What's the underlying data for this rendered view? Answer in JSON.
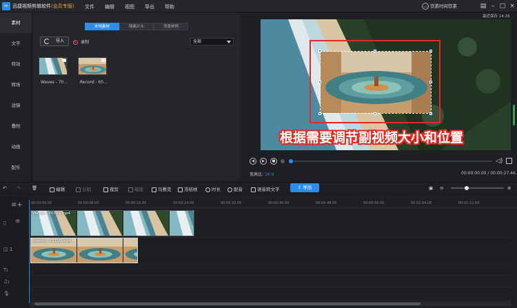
{
  "app": {
    "title": "迅捷视频剪辑软件",
    "edition": "(会员专版)",
    "menu": [
      "文件",
      "编辑",
      "视图",
      "导出",
      "帮助"
    ],
    "user": "饮茶时间饮茶",
    "save_status": "最近保存 14:26",
    "accent": "#2f8dea"
  },
  "sidebar": {
    "items": [
      {
        "label": "素材",
        "active": true
      },
      {
        "label": "文字"
      },
      {
        "label": "特效"
      },
      {
        "label": "转场"
      },
      {
        "label": "滤镜"
      },
      {
        "label": "叠附"
      },
      {
        "label": "动画"
      },
      {
        "label": "配乐"
      }
    ]
  },
  "media": {
    "tabs": [
      "本地素材",
      "隔离片头",
      "背景样例"
    ],
    "import_label": "导入",
    "record_label": "录制",
    "filter_value": "全部",
    "items": [
      {
        "name": "Waves - 70..."
      },
      {
        "name": "Record - 65..."
      }
    ]
  },
  "preview": {
    "caption": "根据需要调节副视频大小和位置",
    "aspect_label": "宽高比:",
    "aspect_value": "16:9",
    "timecode": "00:00:00.00 / 00:00:27.46",
    "progress": 0.0
  },
  "toolbar": {
    "edit": "编辑",
    "split": "分割",
    "crop": "裁剪",
    "zoom": "缩放",
    "mosaic": "马赛克",
    "freeze": "冻结帧",
    "duration": "时长",
    "dub": "配音",
    "tts": "语音转文字",
    "export": "导出"
  },
  "timeline": {
    "ticks": [
      "00:00:00.00",
      "00:00:08.00",
      "00:00:16.00",
      "00:00:24.00",
      "00:00:32.00",
      "00:00:40.00",
      "00:00:48.00",
      "00:00:56.00",
      "00:01:04.00",
      "00:01:12.00"
    ],
    "video_clip": "Waves - 70796.mp4",
    "pip_clip": "Record - 65156.mp4",
    "zoom_level": 0.3
  }
}
